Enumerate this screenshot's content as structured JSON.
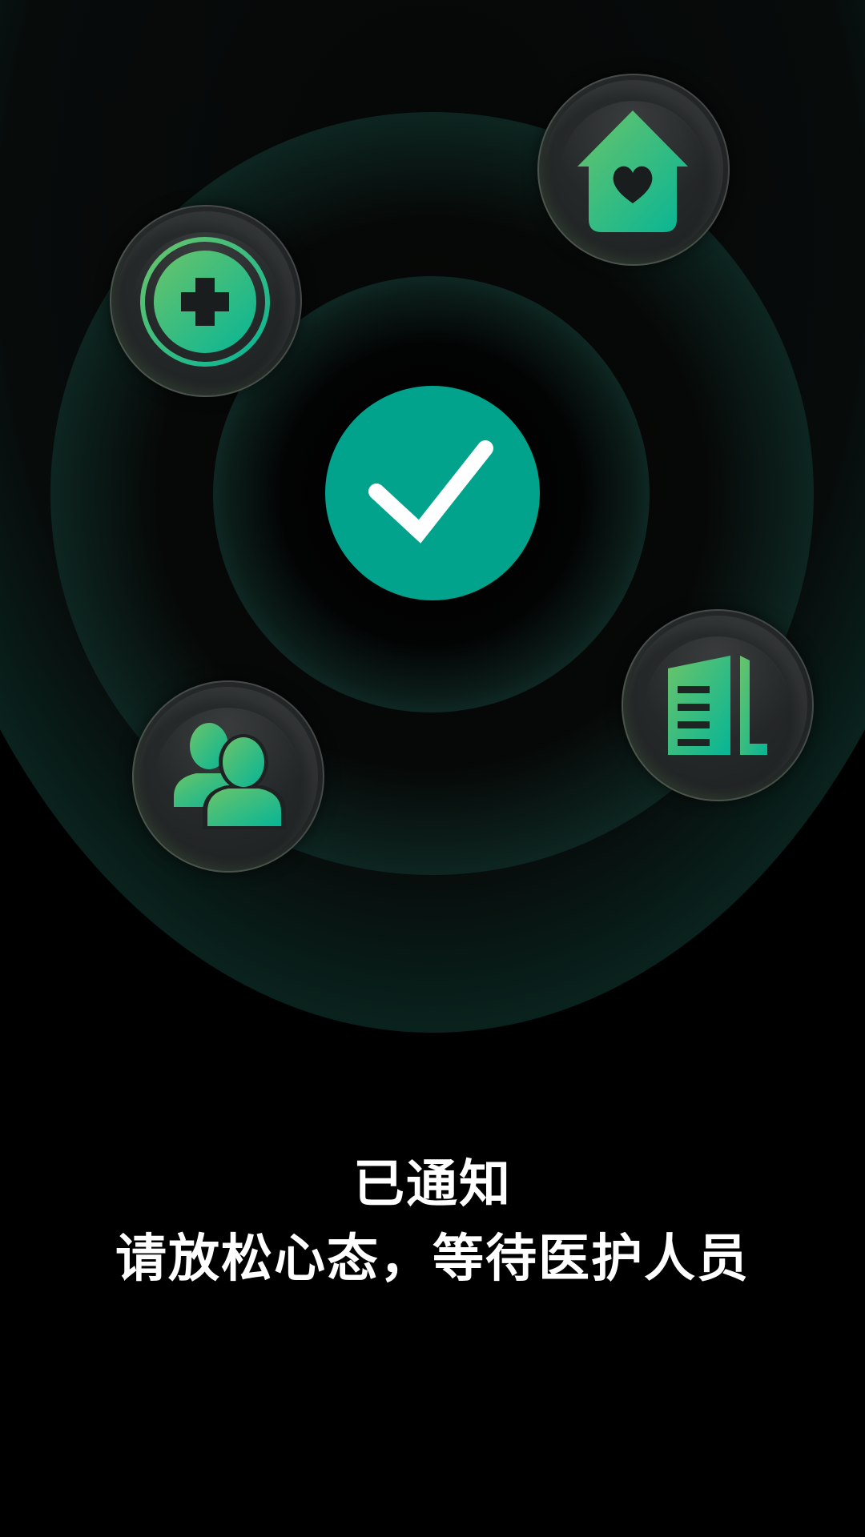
{
  "colors": {
    "background": "#000000",
    "accent_teal": "#01a38c",
    "icon_gradient_start": "#6bc46a",
    "icon_gradient_end": "#06b596",
    "text": "#ffffff"
  },
  "center_icon": "check-icon",
  "orbit_icons": [
    "medical-cross-icon",
    "home-heart-icon",
    "people-icon",
    "building-icon"
  ],
  "status": {
    "title": "已通知",
    "subtitle": "请放松心态，等待医护人员"
  }
}
